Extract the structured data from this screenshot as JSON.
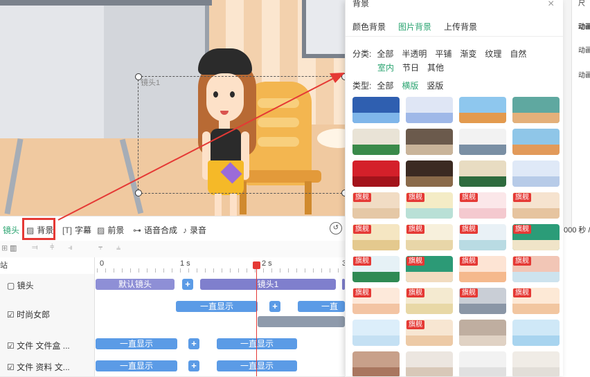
{
  "canvas": {
    "shot_label": "镜头1"
  },
  "right_strip": {
    "line1": "尺",
    "line2": "动画",
    "line3": "动画",
    "line4": "动画",
    "time_suffix": "000 秒 /"
  },
  "toolbar": {
    "shot": "镜头",
    "background": "背景",
    "subtitle": "字幕",
    "foreground": "前景",
    "tts": "语音合成",
    "record": "录音"
  },
  "ruler": {
    "left_label": "站",
    "t0": "0",
    "t1": "1 s",
    "t2": "2 s",
    "t3": "3"
  },
  "tracks": [
    {
      "name": "镜头",
      "clips": [
        "默认镜头",
        "镜头1"
      ]
    },
    {
      "name": "时尚女郎",
      "clips": [
        "一直显示",
        "一直显"
      ]
    },
    {
      "name": "文件 文件盒 ...",
      "clips": [
        "一直显示",
        "一直显示"
      ]
    },
    {
      "name": "文件 资料 文...",
      "clips": [
        "一直显示",
        "一直显示"
      ]
    }
  ],
  "bg_panel": {
    "title": "背景",
    "close": "×",
    "tabs": [
      "颜色背景",
      "图片背景",
      "上传背景"
    ],
    "active_tab": "图片背景",
    "category_label": "分类:",
    "categories_row1": [
      "全部",
      "半透明",
      "平铺",
      "渐变",
      "纹理",
      "自然"
    ],
    "categories_row2": [
      "室内",
      "节日",
      "其他"
    ],
    "active_category": "室内",
    "type_label": "类型:",
    "types": [
      "全部",
      "横版",
      "竖版"
    ],
    "active_type": "横版",
    "badge_text": "旗舰",
    "thumbnails": [
      {
        "colors": [
          "#2f5fb0",
          "#7fb6ea"
        ],
        "badge": false
      },
      {
        "colors": [
          "#dfe6f5",
          "#9fb8e8"
        ],
        "badge": false
      },
      {
        "colors": [
          "#8ec7ee",
          "#e39a4e"
        ],
        "badge": false
      },
      {
        "colors": [
          "#5fa8a0",
          "#e4b07a"
        ],
        "badge": false
      },
      {
        "colors": [
          "#e9e3d6",
          "#3a8a4a"
        ],
        "badge": false
      },
      {
        "colors": [
          "#6b5a4c",
          "#c9b49a"
        ],
        "badge": false
      },
      {
        "colors": [
          "#f2f2f2",
          "#7a8fa4"
        ],
        "badge": false
      },
      {
        "colors": [
          "#8fc6e8",
          "#e29a5a"
        ],
        "badge": false
      },
      {
        "colors": [
          "#d4202a",
          "#a3131b"
        ],
        "badge": false
      },
      {
        "colors": [
          "#3b2a22",
          "#8a6a4a"
        ],
        "badge": false
      },
      {
        "colors": [
          "#e8dcc2",
          "#2e6b3e"
        ],
        "badge": false
      },
      {
        "colors": [
          "#dfe9f7",
          "#b7cbe8"
        ],
        "badge": false
      },
      {
        "colors": [
          "#f1dcc4",
          "#e5c8a6"
        ],
        "badge": true
      },
      {
        "colors": [
          "#f4ecc6",
          "#b9e0d6"
        ],
        "badge": true
      },
      {
        "colors": [
          "#fbe7e9",
          "#f4c9cf"
        ],
        "badge": true
      },
      {
        "colors": [
          "#f6e3cf",
          "#e6c49f"
        ],
        "badge": true
      },
      {
        "colors": [
          "#f5e6c2",
          "#e4c98e"
        ],
        "badge": true
      },
      {
        "colors": [
          "#f7f0dc",
          "#e8d6a8"
        ],
        "badge": true
      },
      {
        "colors": [
          "#e9f1f6",
          "#b9dbe3"
        ],
        "badge": true
      },
      {
        "colors": [
          "#2b9c78",
          "#f0e4c8"
        ],
        "badge": true
      },
      {
        "colors": [
          "#e6f1f6",
          "#2f8a54"
        ],
        "badge": true
      },
      {
        "colors": [
          "#2c9a76",
          "#f2dcc0"
        ],
        "badge": true
      },
      {
        "colors": [
          "#fde4d4",
          "#f5b98d"
        ],
        "badge": true
      },
      {
        "colors": [
          "#f2c6b6",
          "#cde3ee"
        ],
        "badge": true
      },
      {
        "colors": [
          "#fde9da",
          "#f3c4a3"
        ],
        "badge": true
      },
      {
        "colors": [
          "#f4ead0",
          "#e8d8a6"
        ],
        "badge": true
      },
      {
        "colors": [
          "#c9ced6",
          "#8a96a6"
        ],
        "badge": true
      },
      {
        "colors": [
          "#fde9d6",
          "#f2c6a0"
        ],
        "badge": true
      },
      {
        "colors": [
          "#dceefa",
          "#c4e0f3"
        ],
        "badge": false
      },
      {
        "colors": [
          "#f7e6d2",
          "#edcaa6"
        ],
        "badge": true
      },
      {
        "colors": [
          "#bfaea0",
          "#e0d2c4"
        ],
        "badge": false
      },
      {
        "colors": [
          "#cfe8f7",
          "#a8d4ef"
        ],
        "badge": false
      },
      {
        "colors": [
          "#c8a08a",
          "#a9765f"
        ],
        "badge": false
      },
      {
        "colors": [
          "#ece6e0",
          "#d8c8b8"
        ],
        "badge": false
      },
      {
        "colors": [
          "#f2f2f2",
          "#e0e0e0"
        ],
        "badge": false
      },
      {
        "colors": [
          "#f0ece6",
          "#e2ded8"
        ],
        "badge": false
      }
    ]
  },
  "colors": {
    "accent_green": "#2ba471",
    "highlight_red": "#e53935",
    "clip_blue": "#5b9be6",
    "clip_purple": "#8e8fd6"
  }
}
